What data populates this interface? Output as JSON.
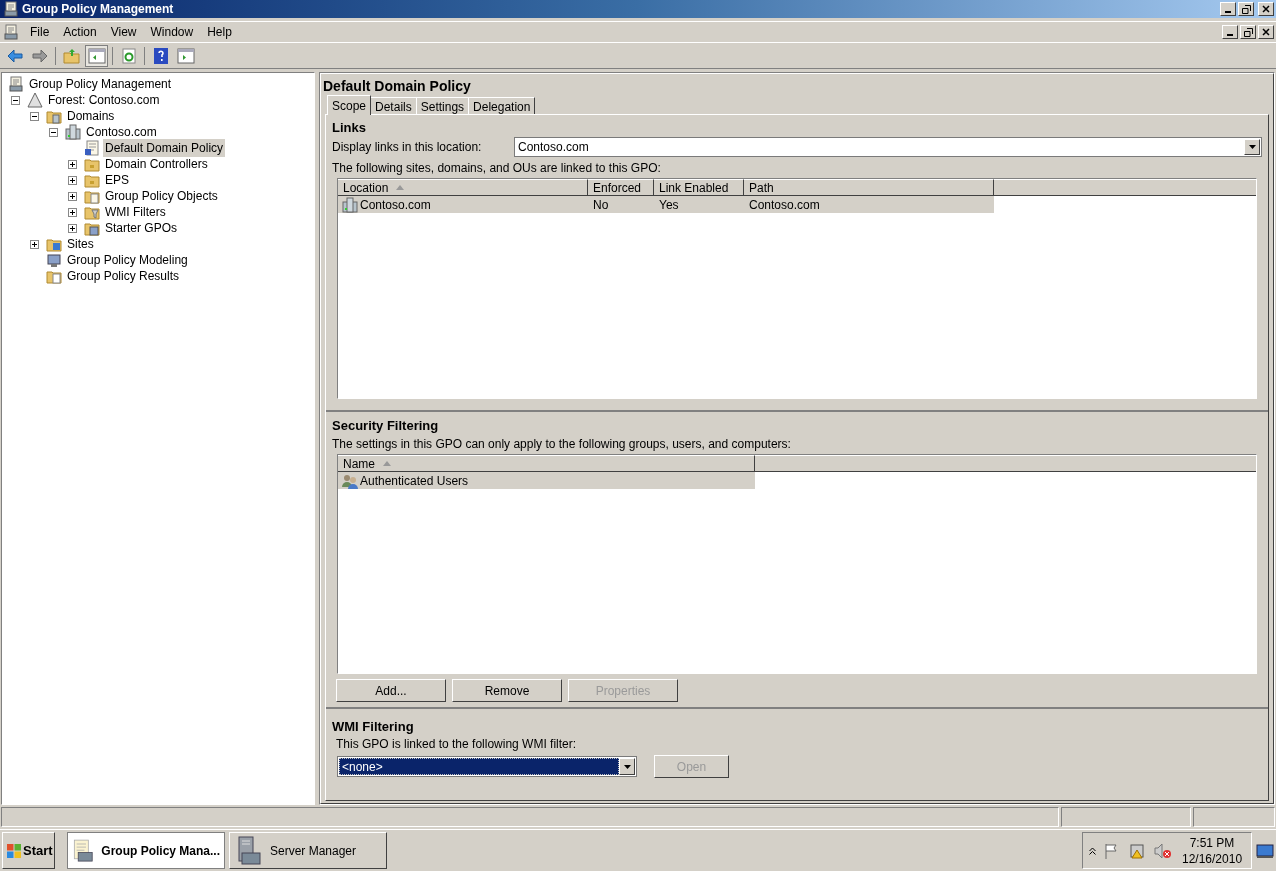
{
  "window": {
    "title": "Group Policy Management"
  },
  "menu": [
    "File",
    "Action",
    "View",
    "Window",
    "Help"
  ],
  "tree": [
    {
      "label": "Group Policy Management",
      "kind": "console",
      "selected": false,
      "children": [
        {
          "label": "Forest: Contoso.com",
          "kind": "forest",
          "expanded": true,
          "selected": false,
          "children": [
            {
              "label": "Domains",
              "kind": "domains",
              "expanded": true,
              "selected": false,
              "children": [
                {
                  "label": "Contoso.com",
                  "kind": "domain",
                  "expanded": true,
                  "selected": false,
                  "children": [
                    {
                      "label": "Default Domain Policy",
                      "kind": "policy",
                      "selected": true
                    },
                    {
                      "label": "Domain Controllers",
                      "kind": "ou",
                      "expanded": false,
                      "selected": false
                    },
                    {
                      "label": "EPS",
                      "kind": "ou",
                      "expanded": false,
                      "selected": false
                    },
                    {
                      "label": "Group Policy Objects",
                      "kind": "gpofolder",
                      "expanded": false,
                      "selected": false
                    },
                    {
                      "label": "WMI Filters",
                      "kind": "wmi",
                      "expanded": false,
                      "selected": false
                    },
                    {
                      "label": "Starter GPOs",
                      "kind": "starter",
                      "expanded": false,
                      "selected": false
                    }
                  ]
                }
              ]
            },
            {
              "label": "Sites",
              "kind": "sites",
              "expanded": false,
              "selected": false
            },
            {
              "label": "Group Policy Modeling",
              "kind": "modeling",
              "selected": false
            },
            {
              "label": "Group Policy Results",
              "kind": "results",
              "selected": false
            }
          ]
        }
      ]
    }
  ],
  "details": {
    "title": "Default Domain Policy",
    "tabs": [
      {
        "label": "Scope",
        "selected": true
      },
      {
        "label": "Details",
        "selected": false
      },
      {
        "label": "Settings",
        "selected": false
      },
      {
        "label": "Delegation",
        "selected": false
      }
    ],
    "links": {
      "heading": "Links",
      "location_label": "Display links in this location:",
      "location_value": "Contoso.com",
      "caption": "The following sites, domains, and OUs are linked to this GPO:",
      "columns": [
        {
          "label": "Location",
          "sorted": true
        },
        {
          "label": "Enforced",
          "sorted": false
        },
        {
          "label": "Link Enabled",
          "sorted": false
        },
        {
          "label": "Path",
          "sorted": false
        }
      ],
      "rows": [
        {
          "cells": [
            "Contoso.com",
            "No",
            "Yes",
            "Contoso.com"
          ],
          "selected": true
        }
      ]
    },
    "security": {
      "heading": "Security Filtering",
      "caption": "The settings in this GPO can only apply to the following groups, users, and computers:",
      "columns": [
        {
          "label": "Name",
          "sorted": true
        }
      ],
      "rows": [
        {
          "cells": [
            "Authenticated Users"
          ],
          "selected": true
        }
      ],
      "buttons": [
        {
          "label": "Add...",
          "disabled": false
        },
        {
          "label": "Remove",
          "disabled": false
        },
        {
          "label": "Properties",
          "disabled": true
        }
      ]
    },
    "wmi": {
      "heading": "WMI Filtering",
      "caption": "This GPO is linked to the following WMI filter:",
      "value": "<none>",
      "focused": true,
      "button": {
        "label": "Open",
        "disabled": true
      }
    }
  },
  "taskbar": {
    "start": "Start",
    "tasks": [
      {
        "label": "Group Policy Mana...",
        "kind": "policy",
        "selected": true
      },
      {
        "label": "Server Manager",
        "kind": "server",
        "selected": false
      }
    ],
    "time": "7:51 PM",
    "date": "12/16/2010"
  }
}
